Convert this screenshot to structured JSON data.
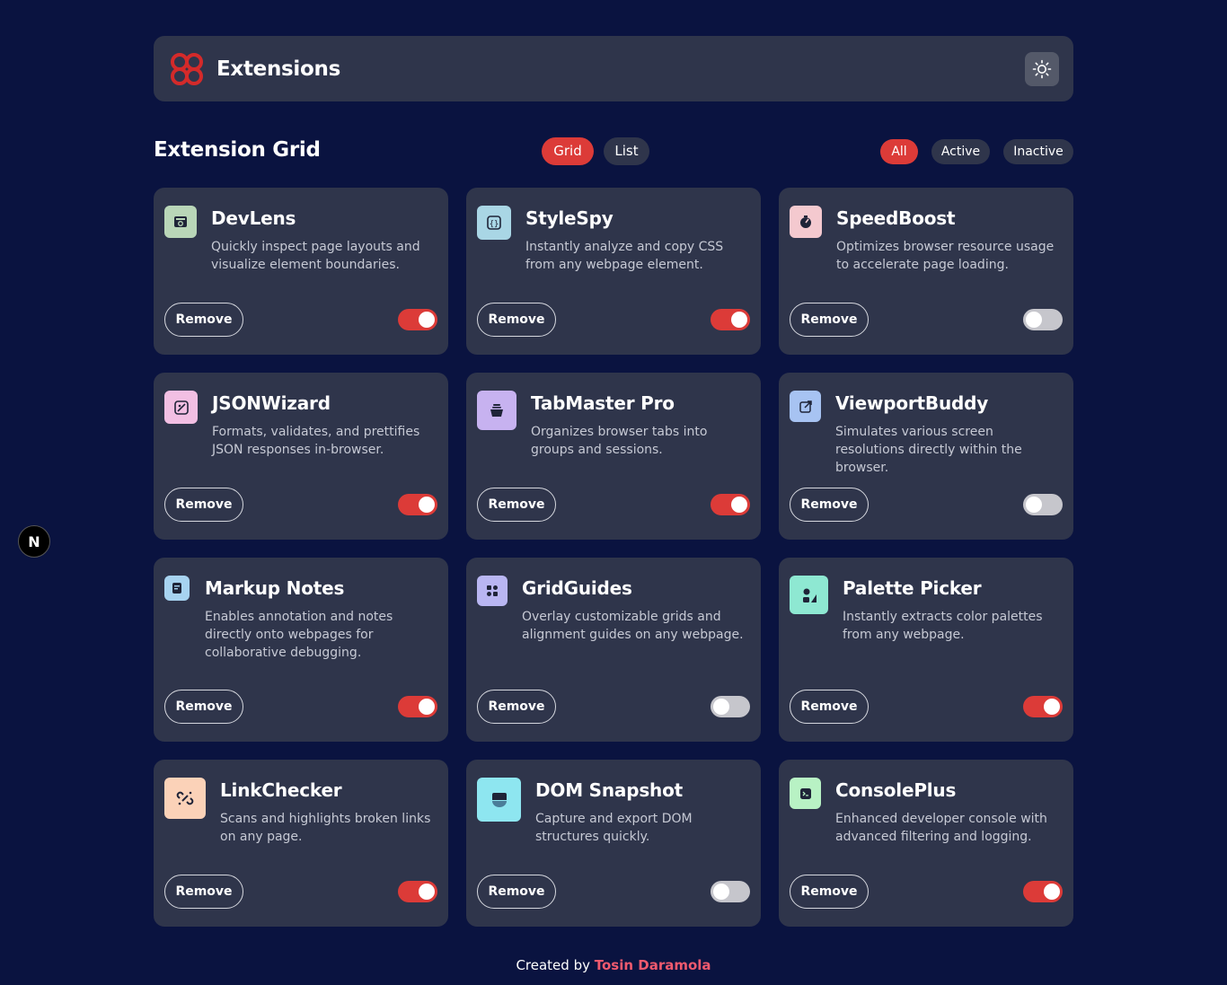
{
  "header": {
    "title": "Extensions",
    "logo_icon": "logo-icon",
    "theme_icon": "sun-icon"
  },
  "toolbar": {
    "title": "Extension Grid",
    "view_options": [
      "Grid",
      "List"
    ],
    "active_view": "Grid",
    "filters": [
      "All",
      "Active",
      "Inactive"
    ],
    "active_filter": "All"
  },
  "colors": {
    "background": "#0a1340",
    "card": "#2f354b",
    "accent": "#dc3b38",
    "toggle_off": "#c6c6cc"
  },
  "extensions": [
    {
      "name": "DevLens",
      "description": "Quickly inspect page layouts and visualize element boundaries.",
      "remove_label": "Remove",
      "enabled": true,
      "icon": "devlens-icon"
    },
    {
      "name": "StyleSpy",
      "description": "Instantly analyze and copy CSS from any webpage element.",
      "remove_label": "Remove",
      "enabled": true,
      "icon": "stylespy-icon"
    },
    {
      "name": "SpeedBoost",
      "description": "Optimizes browser resource usage to accelerate page loading.",
      "remove_label": "Remove",
      "enabled": false,
      "icon": "speedboost-icon"
    },
    {
      "name": "JSONWizard",
      "description": "Formats, validates, and prettifies JSON responses in-browser.",
      "remove_label": "Remove",
      "enabled": true,
      "icon": "jsonwizard-icon"
    },
    {
      "name": "TabMaster Pro",
      "description": "Organizes browser tabs into groups and sessions.",
      "remove_label": "Remove",
      "enabled": true,
      "icon": "tabmaster-icon"
    },
    {
      "name": "ViewportBuddy",
      "description": "Simulates various screen resolutions directly within the browser.",
      "remove_label": "Remove",
      "enabled": false,
      "icon": "viewportbuddy-icon"
    },
    {
      "name": "Markup Notes",
      "description": "Enables annotation and notes directly onto webpages for collaborative debugging.",
      "remove_label": "Remove",
      "enabled": true,
      "icon": "markup-notes-icon"
    },
    {
      "name": "GridGuides",
      "description": "Overlay customizable grids and alignment guides on any webpage.",
      "remove_label": "Remove",
      "enabled": false,
      "icon": "gridguides-icon"
    },
    {
      "name": "Palette Picker",
      "description": "Instantly extracts color palettes from any webpage.",
      "remove_label": "Remove",
      "enabled": true,
      "icon": "palette-picker-icon"
    },
    {
      "name": "LinkChecker",
      "description": "Scans and highlights broken links on any page.",
      "remove_label": "Remove",
      "enabled": true,
      "icon": "linkchecker-icon"
    },
    {
      "name": "DOM Snapshot",
      "description": "Capture and export DOM structures quickly.",
      "remove_label": "Remove",
      "enabled": false,
      "icon": "dom-snapshot-icon"
    },
    {
      "name": "ConsolePlus",
      "description": "Enhanced developer console with advanced filtering and logging.",
      "remove_label": "Remove",
      "enabled": true,
      "icon": "consoleplus-icon"
    }
  ],
  "dev_badge": {
    "label": "N"
  },
  "footer": {
    "prefix": "Created by",
    "author": "Tosin Daramola"
  }
}
